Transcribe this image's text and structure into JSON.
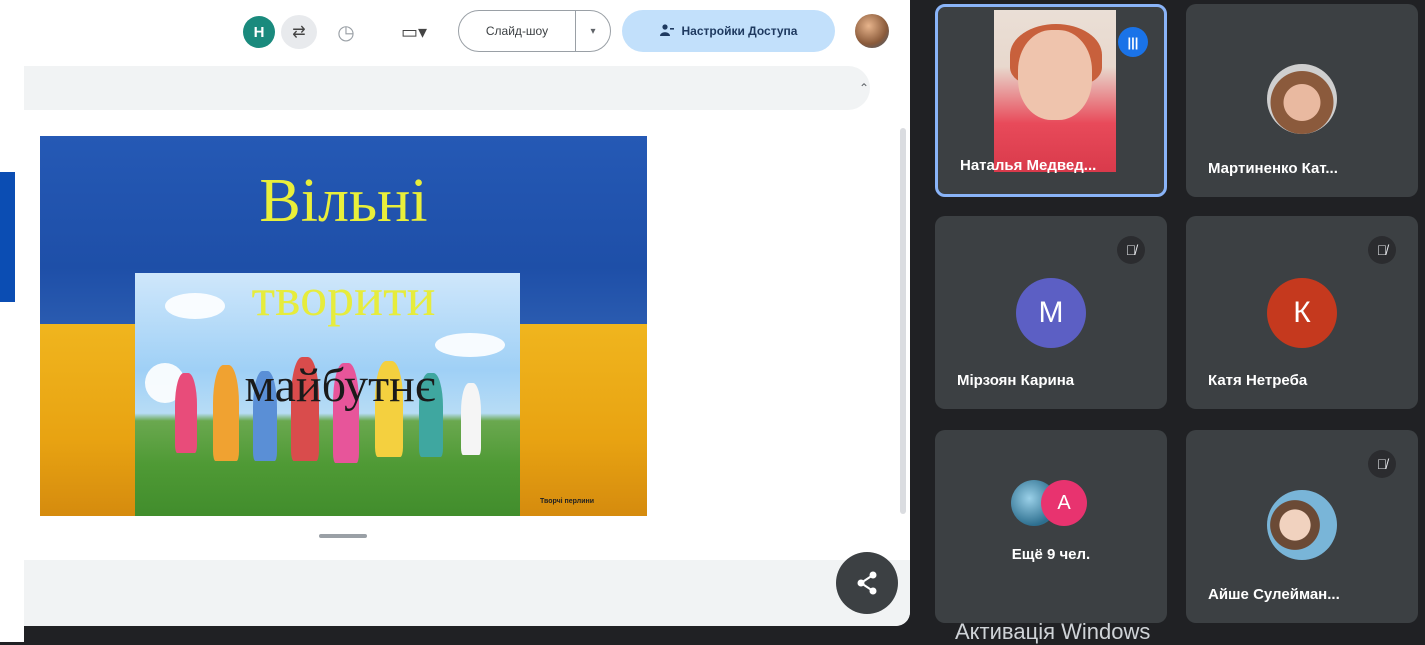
{
  "toolbar": {
    "user_initial": "Н",
    "slideshow_label": "Слайд-шоу",
    "dropdown_arrow": "▾",
    "share_label": "Настройки Доступа",
    "collapse_arrow": "⌃"
  },
  "slide": {
    "title_line1": "Вільні",
    "title_line2": "творити",
    "title_line3": "майбутнє",
    "caption": "Творчі перлини"
  },
  "participants": [
    {
      "name": "Наталья Медвед...",
      "speaking": true
    },
    {
      "name": "Мартиненко Кат..."
    },
    {
      "name": "Мірзоян Карина",
      "initial": "М",
      "color": "#5c5fc4",
      "muted": true
    },
    {
      "name": "Катя Нетреба",
      "initial": "К",
      "color": "#c5391e",
      "muted": true
    },
    {
      "name": "Ещё 9 чел.",
      "extra_initial": "А",
      "extra_color": "#e8336f"
    },
    {
      "name": "Айше Сулейман...",
      "muted": true
    }
  ],
  "watermark": "Активація Windows",
  "colors": {
    "background": "#202124",
    "tile": "#3c4043",
    "active_border": "#8ab4f8",
    "share_button": "#c2e0fb"
  }
}
